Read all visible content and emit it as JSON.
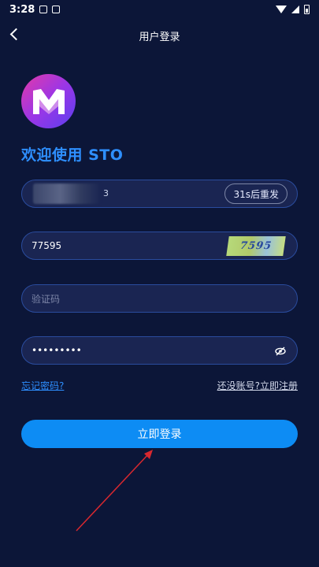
{
  "status_bar": {
    "time": "3:28"
  },
  "nav": {
    "title": "用户登录"
  },
  "welcome": "欢迎使用 STO",
  "phone_field": {
    "partial_value": "3",
    "resend_label": "31s后重发"
  },
  "captcha_field": {
    "value": "77595",
    "captcha_text": "7595"
  },
  "code_field": {
    "placeholder": "验证码"
  },
  "password_field": {
    "value": "•••••••••"
  },
  "links": {
    "forgot": "忘记密码?",
    "register": "还没账号?立即注册"
  },
  "login_button": {
    "label": "立即登录"
  },
  "colors": {
    "background": "#0c1638",
    "accent": "#0d8cf4",
    "link": "#2e8fff",
    "annotation_arrow": "#d9282f"
  }
}
